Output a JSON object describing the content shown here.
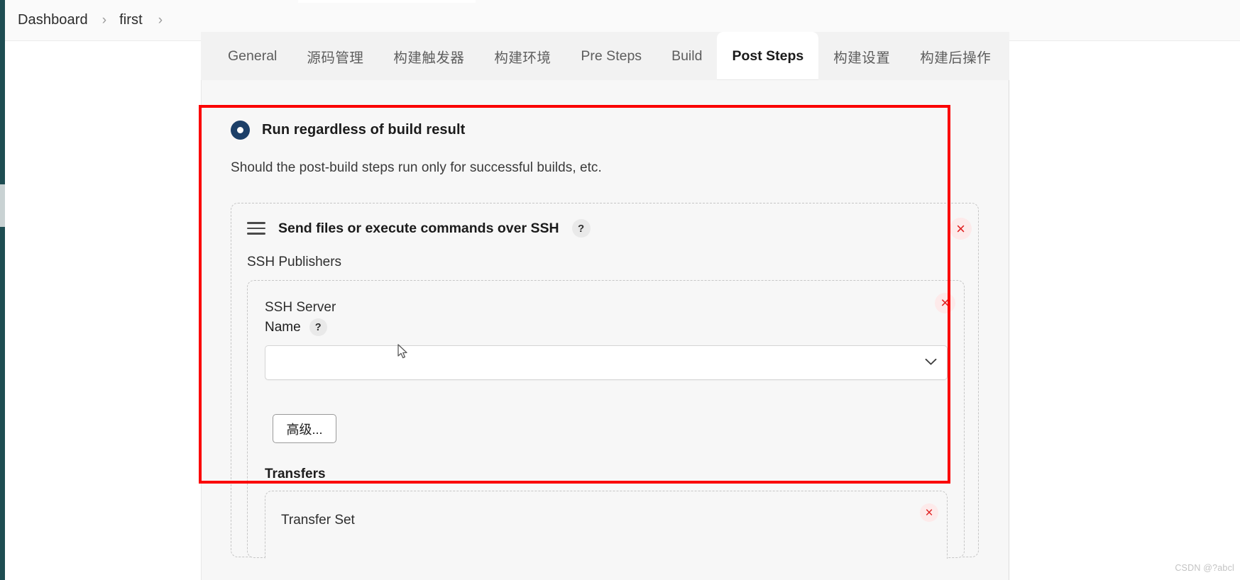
{
  "breadcrumb": {
    "items": [
      {
        "label": "Dashboard"
      },
      {
        "label": "first"
      }
    ],
    "separator": "›"
  },
  "tabs": [
    {
      "label": "General",
      "active": false
    },
    {
      "label": "源码管理",
      "active": false
    },
    {
      "label": "构建触发器",
      "active": false
    },
    {
      "label": "构建环境",
      "active": false
    },
    {
      "label": "Pre Steps",
      "active": false
    },
    {
      "label": "Build",
      "active": false
    },
    {
      "label": "Post Steps",
      "active": true
    },
    {
      "label": "构建设置",
      "active": false
    },
    {
      "label": "构建后操作",
      "active": false
    }
  ],
  "post_steps": {
    "radio_label": "Run regardless of build result",
    "radio_selected": true,
    "description": "Should the post-build steps run only for successful builds, etc.",
    "ssh_panel": {
      "title": "Send files or execute commands over SSH",
      "help": "?",
      "remove": "×",
      "publishers_label": "SSH Publishers",
      "server": {
        "label_line1": "SSH Server",
        "label_line2": "Name",
        "help": "?",
        "remove": "×",
        "select_value": "",
        "select_placeholder": "",
        "advanced_button": "高级...",
        "transfers_label": "Transfers",
        "transfer_set": {
          "label": "Transfer Set",
          "remove": "×"
        }
      }
    }
  },
  "annotation": {
    "color": "#fb0000"
  },
  "colors": {
    "accent": "#1c3f68",
    "annotation": "#fb0000",
    "remove": "#e02020",
    "panel_bg": "#f7f7f7"
  },
  "watermark": "CSDN @?abcl"
}
